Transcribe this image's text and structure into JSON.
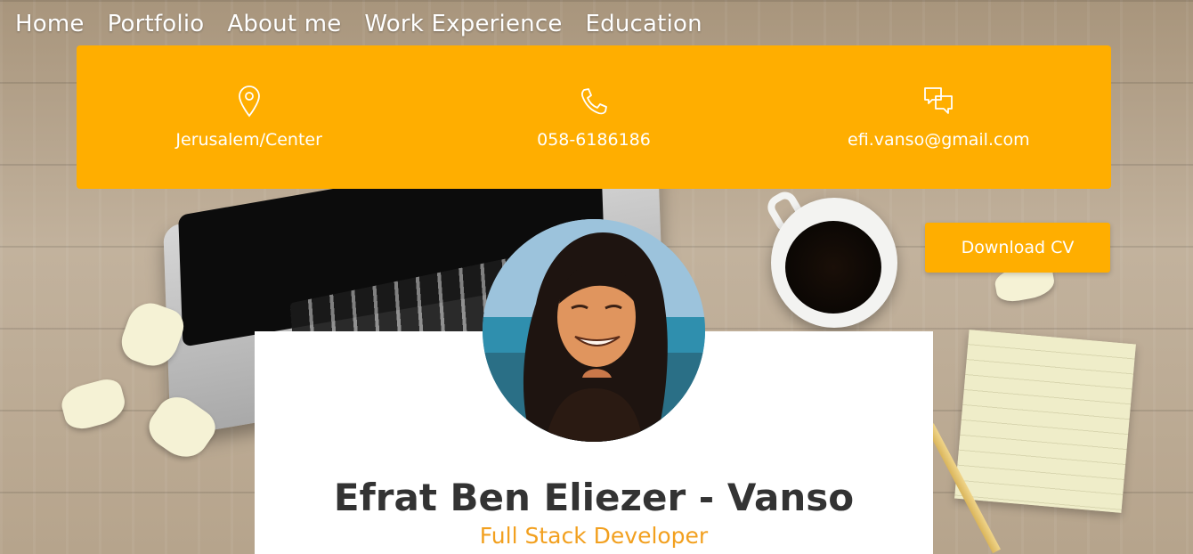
{
  "nav": {
    "items": [
      {
        "label": "Home"
      },
      {
        "label": "Portfolio"
      },
      {
        "label": "About me"
      },
      {
        "label": "Work Experience"
      },
      {
        "label": "Education"
      }
    ]
  },
  "contact": {
    "items": [
      {
        "icon": "location-pin-icon",
        "text": "Jerusalem/Center"
      },
      {
        "icon": "phone-icon",
        "text": "058-6186186"
      },
      {
        "icon": "chat-bubbles-icon",
        "text": "efi.vanso@gmail.com"
      }
    ]
  },
  "download_button": {
    "label": "Download CV"
  },
  "profile": {
    "name": "Efrat Ben Eliezer - Vanso",
    "title": "Full Stack Developer"
  },
  "colors": {
    "accent": "#ffae00",
    "title_accent": "#f2a01f",
    "name_text": "#333333"
  }
}
